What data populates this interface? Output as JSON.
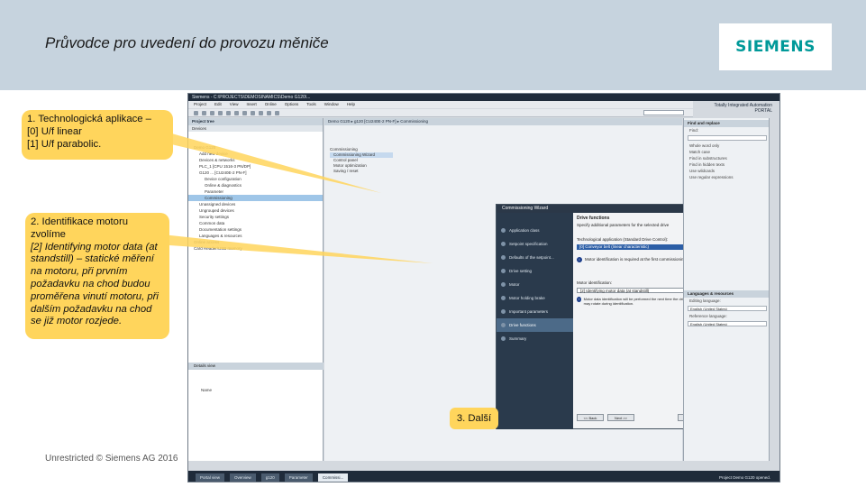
{
  "slide": {
    "title": "Průvodce pro uvedení do provozu měniče",
    "logo": "SIEMENS",
    "footer": "Unrestricted © Siemens AG 2016"
  },
  "callouts": {
    "c1": [
      "1. Technologická aplikace –",
      "[0] U/f linear",
      "[1] U/f parabolic."
    ],
    "c2": [
      "2. Identifikace motoru zvolíme",
      "[2] Identifying motor data (at standstill) – statické měření na motoru, při prvním požadavku na chod budou proměřena vinutí motoru, při dalším požadavku na chod se již motor rozjede."
    ],
    "c3": "3. Další"
  },
  "tia": {
    "titlebar": "Siemens - C:\\PROJECTS\\DEMOSINAMICS\\Demo G120\\...",
    "brand_line1": "Totally Integrated Automation",
    "brand_line2": "PORTAL",
    "menu": [
      "Project",
      "Edit",
      "View",
      "Insert",
      "Online",
      "Options",
      "Tools",
      "Window",
      "Help"
    ],
    "project_tree_title": "Project tree",
    "devices_tab": "Devices",
    "tree": [
      "Demo G120",
      "Add new device",
      "Devices & networks",
      "PLC_1 [CPU 1516-3 PN/DP]",
      "G120 ... [CU240E-2 PN-F]",
      "Device configuration",
      "Online & diagnostics",
      "Parameter",
      "Commissioning",
      "Unassigned devices",
      "Ungrouped devices",
      "Security settings",
      "Common data",
      "Documentation settings",
      "Languages & resources",
      "Online access",
      "Card Reader/USB memory"
    ],
    "details_view": "Details view",
    "details_name": "Name",
    "breadcrumb": "Demo G120 ▸ g120 [CU240E-2 PN-F] ▸ Commissioning",
    "commissioning": [
      "Commissioning",
      "Commissioning Wizard",
      "Control panel",
      "Motor optimization",
      "Saving / reset"
    ],
    "wizard": {
      "title": "Commissioning Wizard",
      "steps": [
        "Application class",
        "Setpoint specification",
        "Defaults of the setpoint...",
        "Drive setting",
        "Motor",
        "Motor holding brake",
        "Important parameters",
        "Drive functions",
        "Summary"
      ],
      "heading": "Drive functions",
      "desc": "Specify additional parameters for the selected drive",
      "tech_label": "Technological application (Standard Drive Control):",
      "tech_value": "[0] Conveyor belt (linear characteristic)",
      "info1": "Motor identification is required at the first commissioning.",
      "motor_id_label": "Motor identification:",
      "motor_id_value": "[2] Identifying motor data (at standstill)",
      "info2": "Motor data identification will be performed the next time the drive is switched on. The motor may rotate during identification.",
      "btn_back": "<< Back",
      "btn_next": "Next >>",
      "btn_finish": "Finish",
      "btn_cancel": "Cancel"
    },
    "find_replace": "Find and replace",
    "find_label": "Find:",
    "options": [
      "Whole word only",
      "Match case",
      "Find in substructures",
      "Find in hidden texts",
      "Use wildcards",
      "Use regular expressions"
    ],
    "languages": "Languages & resources",
    "editing_lang_label": "Editing language:",
    "editing_lang": "English (United States)",
    "ref_lang_label": "Reference language:",
    "ref_lang": "English (United States)",
    "tasks": [
      "Portal view",
      "Overview",
      "g120",
      "Parameter",
      "Commissi..."
    ],
    "status_text": "Project Demo G120 opened."
  }
}
